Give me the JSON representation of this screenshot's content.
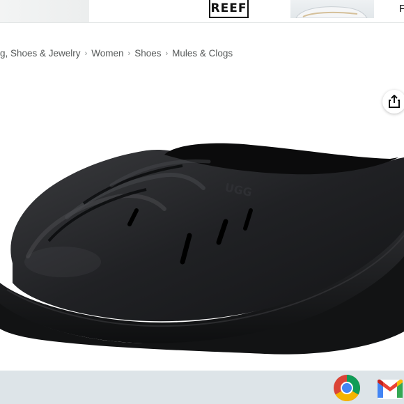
{
  "ad": {
    "brand_logo": "REEF",
    "cut_letter": "F"
  },
  "breadcrumb": {
    "items": [
      "g, Shoes & Jewelry",
      "Women",
      "Shoes",
      "Mules & Clogs"
    ],
    "separator": "›"
  },
  "product_image": {
    "subject": "black-ugg-clog",
    "imprint": "UGG"
  },
  "icons": {
    "share": "share-icon",
    "chrome": "chrome-icon",
    "gmail": "gmail-icon"
  },
  "colors": {
    "shoe": "#1c1d1f",
    "breadcrumb_text": "#565959",
    "shelf": "#dde4e8"
  }
}
